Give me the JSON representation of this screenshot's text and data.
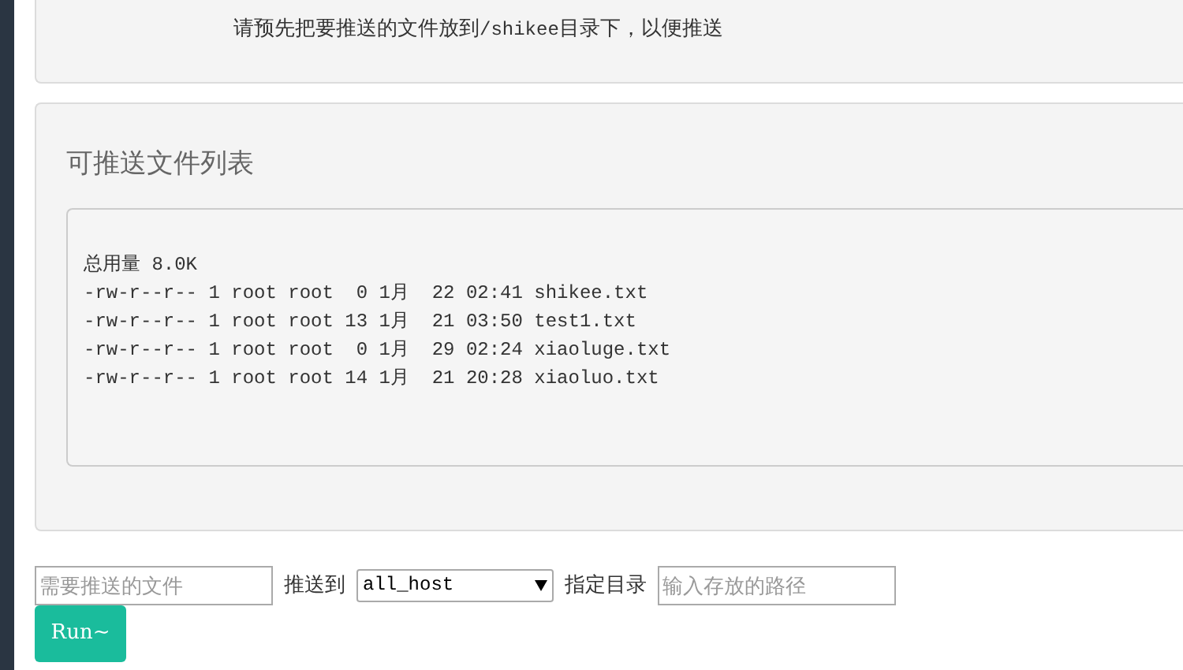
{
  "notice": {
    "before": "请预先把要推送的文件放到",
    "code": "/shikee",
    "after": "目录下，以便推送"
  },
  "file_panel": {
    "title": "可推送文件列表",
    "listing": [
      "总用量 8.0K",
      "-rw-r--r-- 1 root root  0 1月  22 02:41 shikee.txt",
      "-rw-r--r-- 1 root root 13 1月  21 03:50 test1.txt",
      "-rw-r--r-- 1 root root  0 1月  29 02:24 xiaoluge.txt",
      "-rw-r--r-- 1 root root 14 1月  21 20:28 xiaoluo.txt"
    ]
  },
  "form": {
    "file_field": {
      "placeholder": "需要推送的文件"
    },
    "push_to_label": "推送到",
    "target_select": {
      "value": "all_host"
    },
    "dir_label": "指定目录",
    "dir_field": {
      "placeholder": "输入存放的路径"
    },
    "run_button": "Run~"
  }
}
